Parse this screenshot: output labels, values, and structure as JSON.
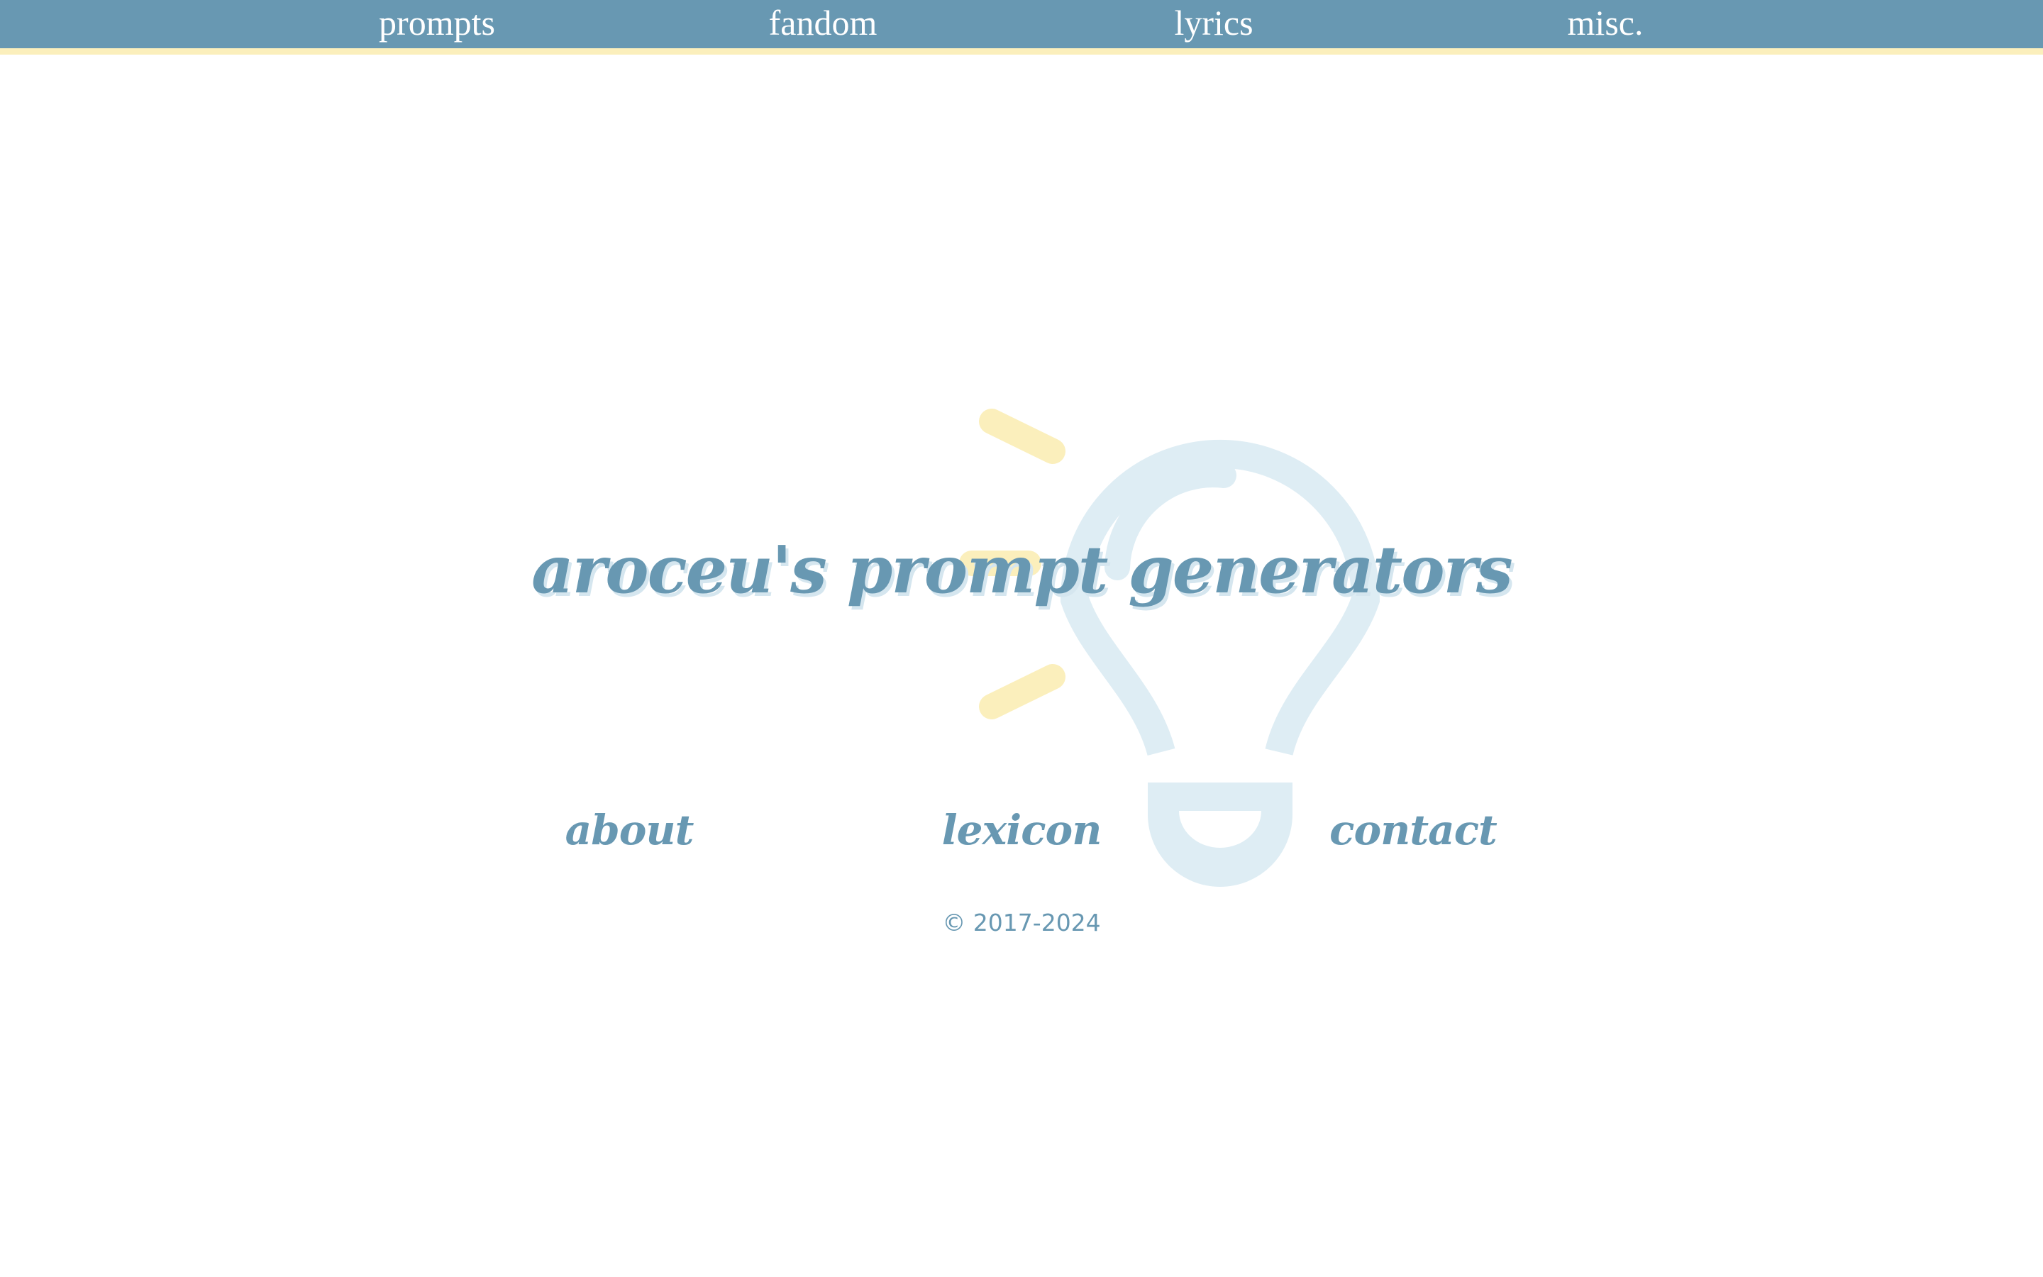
{
  "nav": {
    "items": [
      {
        "label": "prompts"
      },
      {
        "label": "fandom"
      },
      {
        "label": "lyrics"
      },
      {
        "label": "misc."
      }
    ]
  },
  "hero": {
    "title": "aroceu's prompt generators",
    "background_icon": "lightbulb-icon"
  },
  "footer": {
    "links": [
      {
        "label": "about"
      },
      {
        "label": "lexicon"
      },
      {
        "label": "contact"
      }
    ],
    "copyright": "© 2017-2024"
  },
  "colors": {
    "primary_blue": "#6898b2",
    "accent_yellow": "#fbefbc",
    "bulb_light_blue": "#deedf4",
    "background": "#ffffff"
  }
}
